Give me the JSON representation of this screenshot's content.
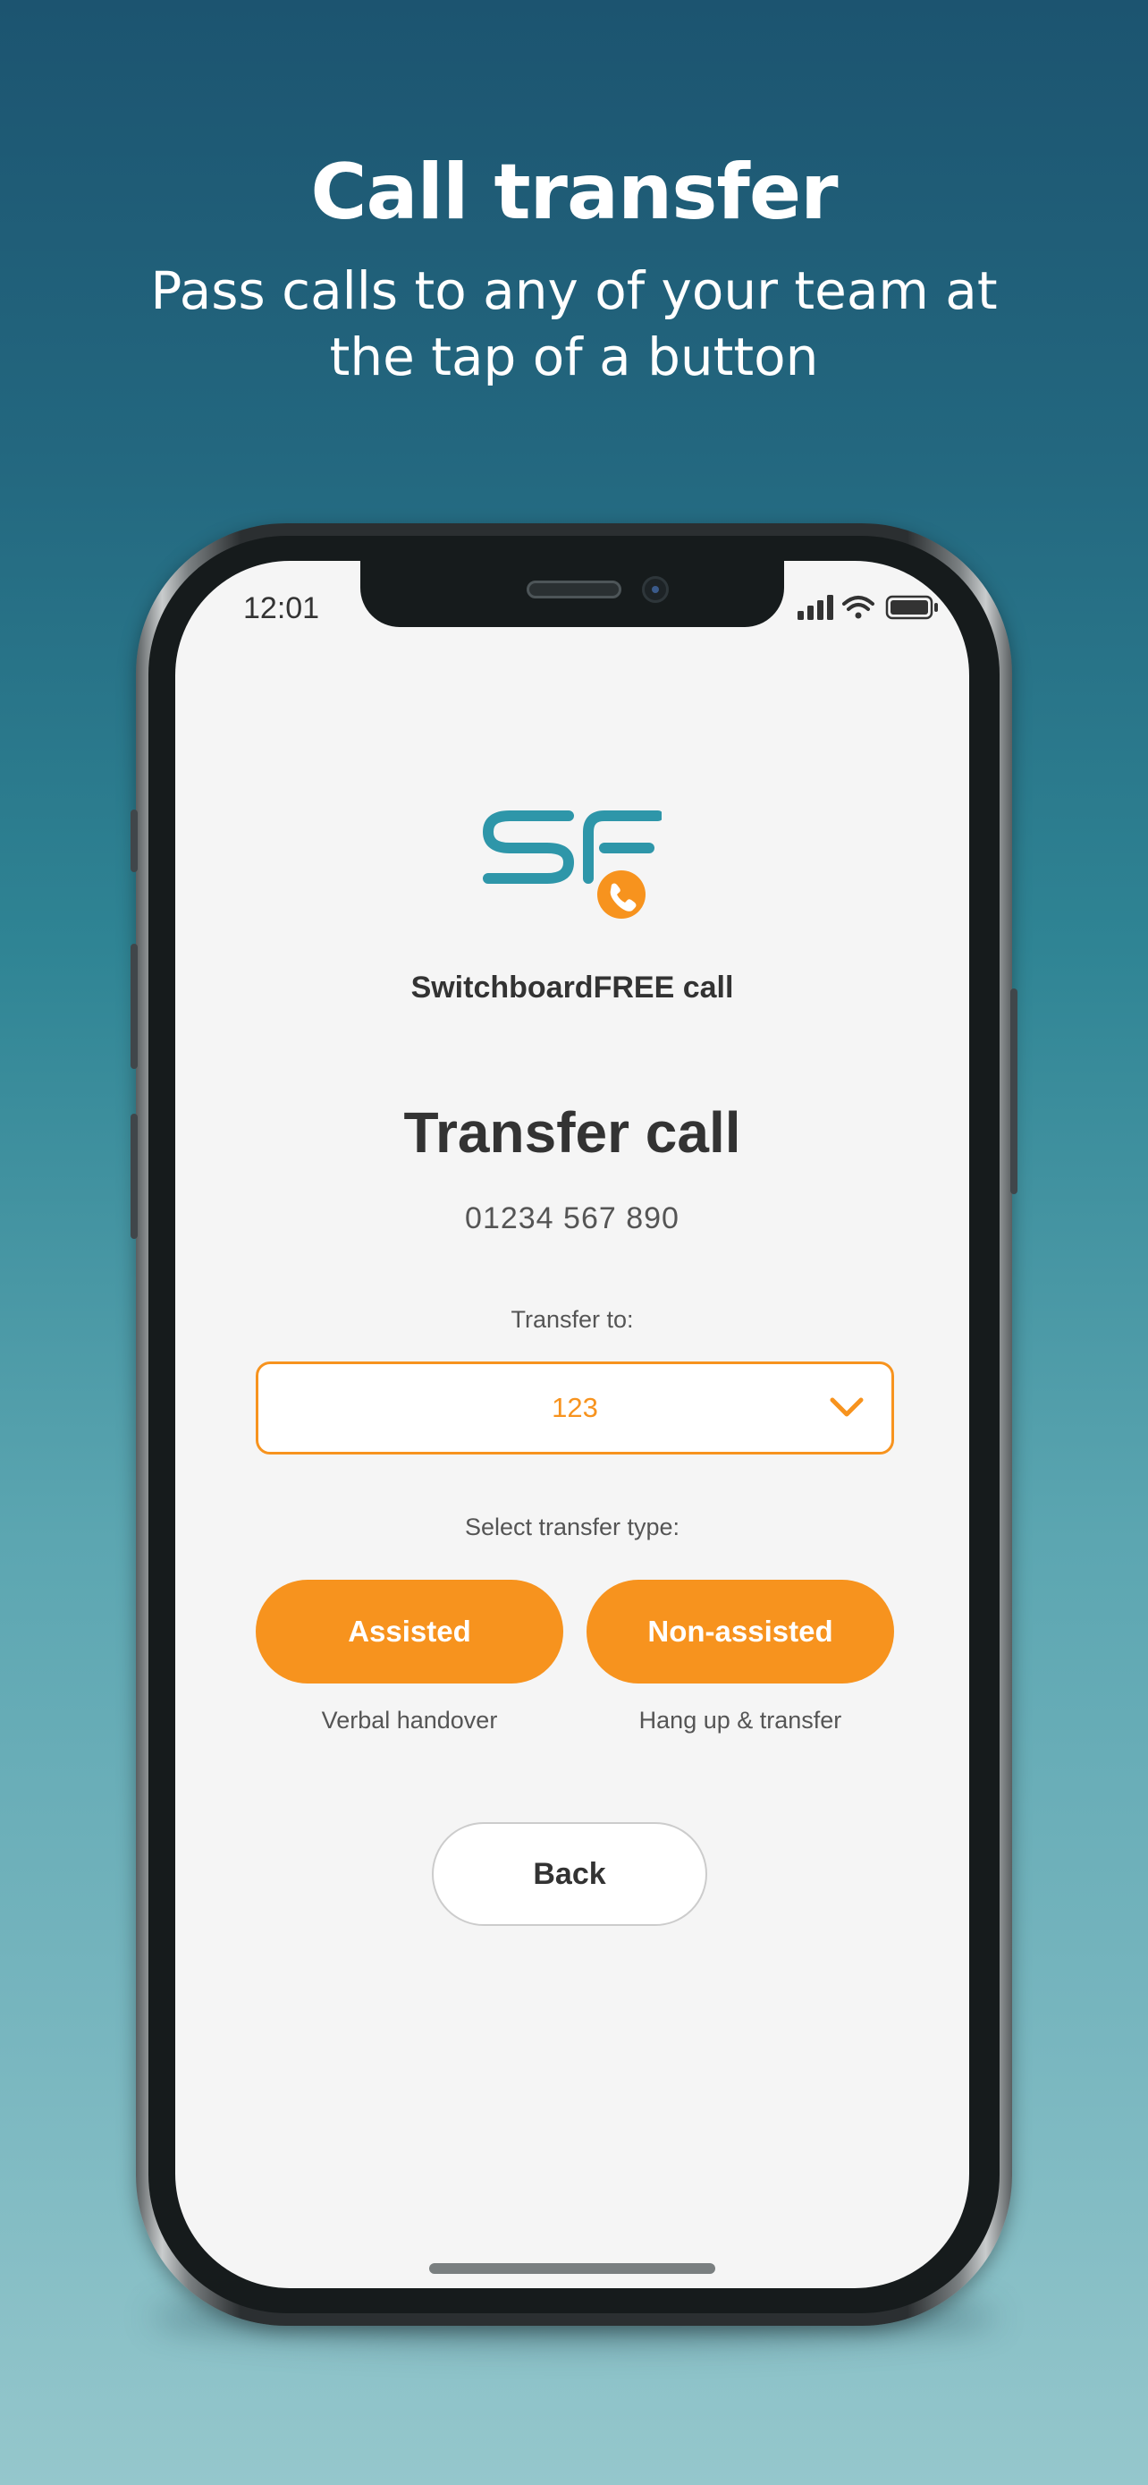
{
  "marketing": {
    "headline": "Call transfer",
    "subheadline": "Pass calls to any of your team at the tap of a button"
  },
  "status_bar": {
    "time": "12:01",
    "icons": [
      "cellular-signal-icon",
      "wifi-icon",
      "battery-icon"
    ]
  },
  "app": {
    "brand_name": "SwitchboardFREE call",
    "logo_text": "SF",
    "logo_icon": "phone-icon"
  },
  "screen": {
    "title": "Transfer call",
    "phone_number": "01234 567 890",
    "transfer_to_label": "Transfer to:",
    "transfer_to_value": "123",
    "select_type_label": "Select transfer type:",
    "assisted_button": "Assisted",
    "assisted_caption": "Verbal handover",
    "non_assisted_button": "Non-assisted",
    "non_assisted_caption": "Hang up & transfer",
    "back_button": "Back"
  },
  "colors": {
    "accent": "#f7931e",
    "brand_teal": "#2e96a9",
    "text_dark": "#333333",
    "screen_bg": "#f5f5f5"
  }
}
